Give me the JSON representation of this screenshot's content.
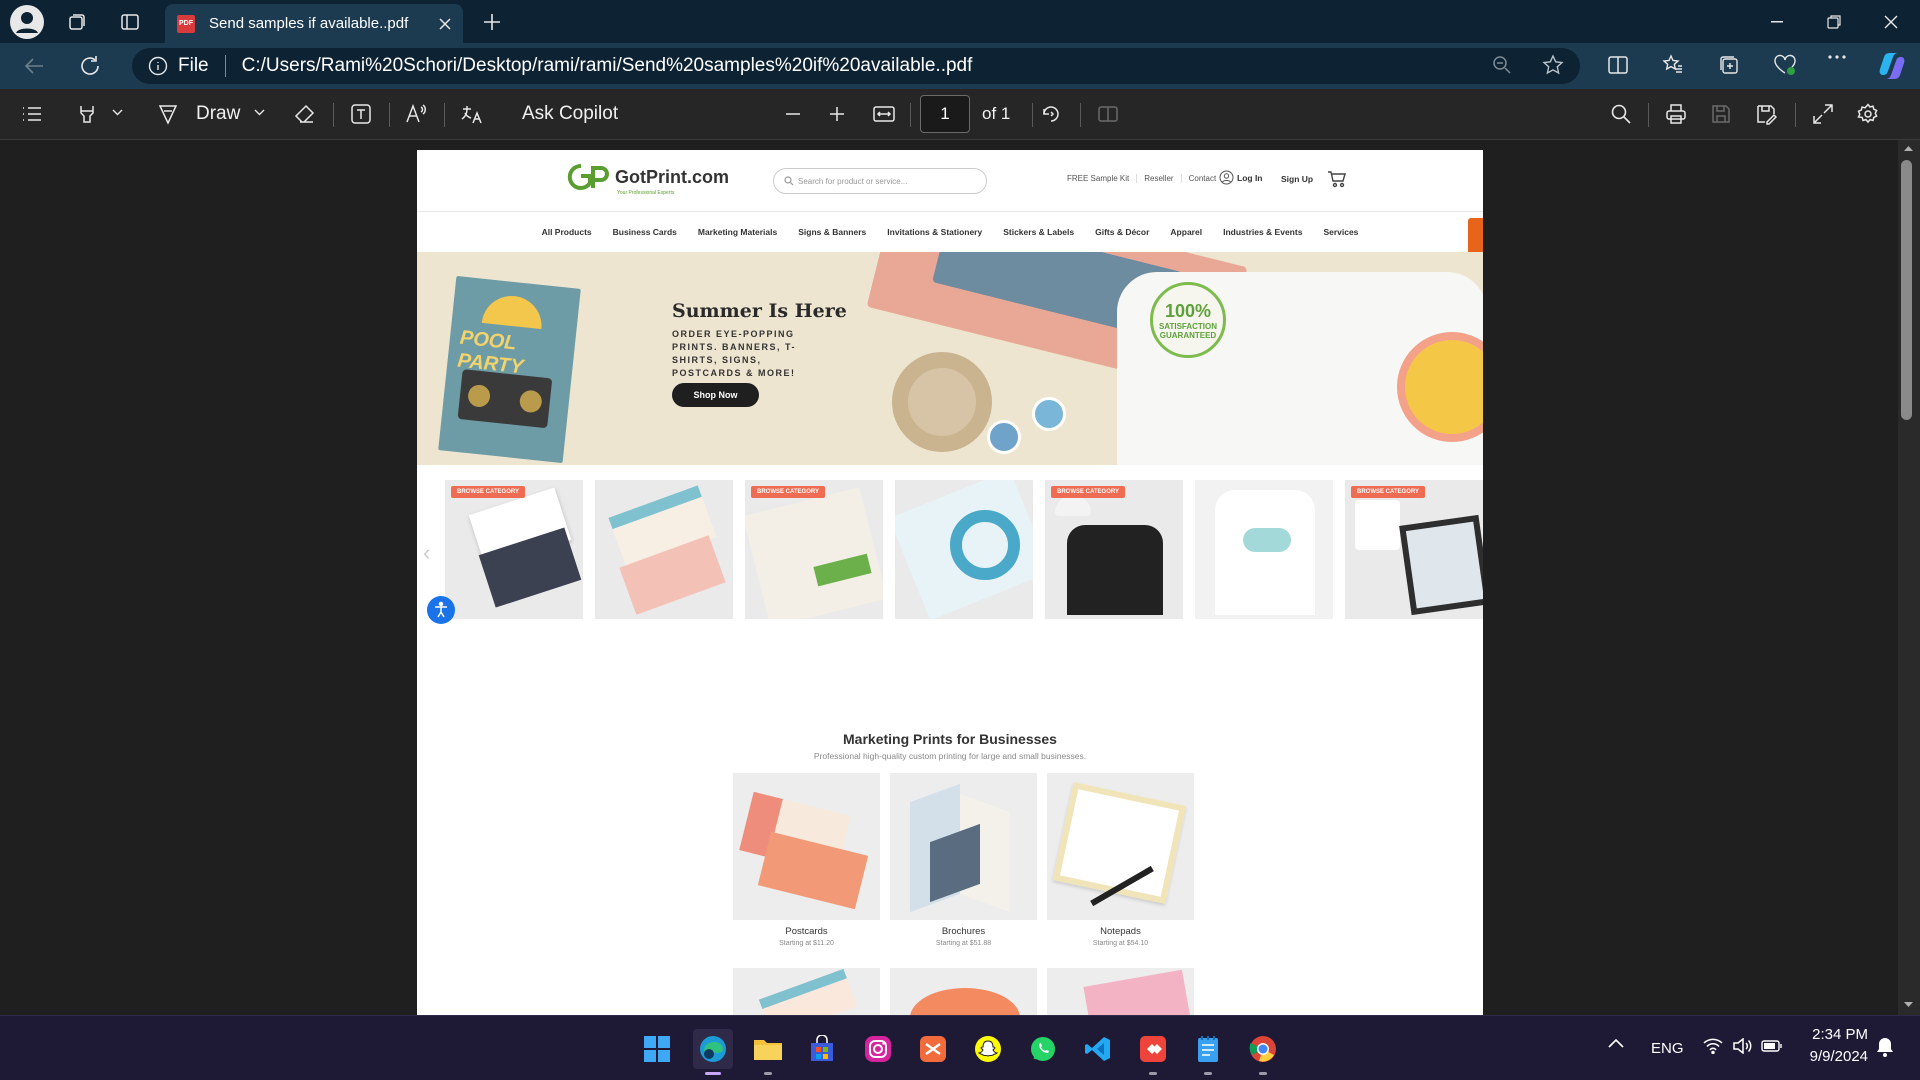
{
  "browser": {
    "tab_title": "Send samples if available..pdf",
    "address_file_label": "File",
    "address_url": "C:/Users/Rami%20Schori/Desktop/rami/rami/Send%20samples%20if%20available..pdf"
  },
  "pdf_toolbar": {
    "draw_label": "Draw",
    "ask_copilot_label": "Ask Copilot",
    "page_current": "1",
    "page_total_label": "of 1"
  },
  "page": {
    "logo_text": "GotPrint.com",
    "logo_tagline": "Your Professional Experts",
    "search_placeholder": "Search for product or service...",
    "header_links": [
      "FREE Sample Kit",
      "Reseller",
      "Contact"
    ],
    "login_label": "Log In",
    "signup_label": "Sign Up",
    "nav": [
      "All Products",
      "Business Cards",
      "Marketing Materials",
      "Signs & Banners",
      "Invitations & Stationery",
      "Stickers & Labels",
      "Gifts & Décor",
      "Apparel",
      "Industries & Events",
      "Services"
    ],
    "hero": {
      "title": "Summer Is Here",
      "subtitle": "ORDER EYE-POPPING PRINTS. BANNERS, T-SHIRTS, SIGNS, POSTCARDS & MORE!",
      "button": "Shop Now",
      "pool_card_text": "POOL PARTY",
      "badge_big": "100%",
      "badge_small": "SATISFACTION GUARANTEED"
    },
    "category_badge": "BROWSE CATEGORY",
    "marketing": {
      "title": "Marketing Prints for Businesses",
      "subtitle": "Professional high-quality custom printing for large and small businesses.",
      "products": [
        {
          "name": "Postcards",
          "price": "Starting at $11.20"
        },
        {
          "name": "Brochures",
          "price": "Starting at $51.88"
        },
        {
          "name": "Notepads",
          "price": "Starting at $54.10"
        }
      ]
    }
  },
  "tray": {
    "language": "ENG",
    "time": "2:34 PM",
    "date": "9/9/2024"
  },
  "colors": {
    "titlebar": "#0d2233",
    "addressbar": "#1c3a50",
    "pdf_toolbar": "#262626",
    "taskbar": "#1e1a35",
    "gotprint_green": "#5a9e2f",
    "badge_coral": "#ef6b52"
  }
}
